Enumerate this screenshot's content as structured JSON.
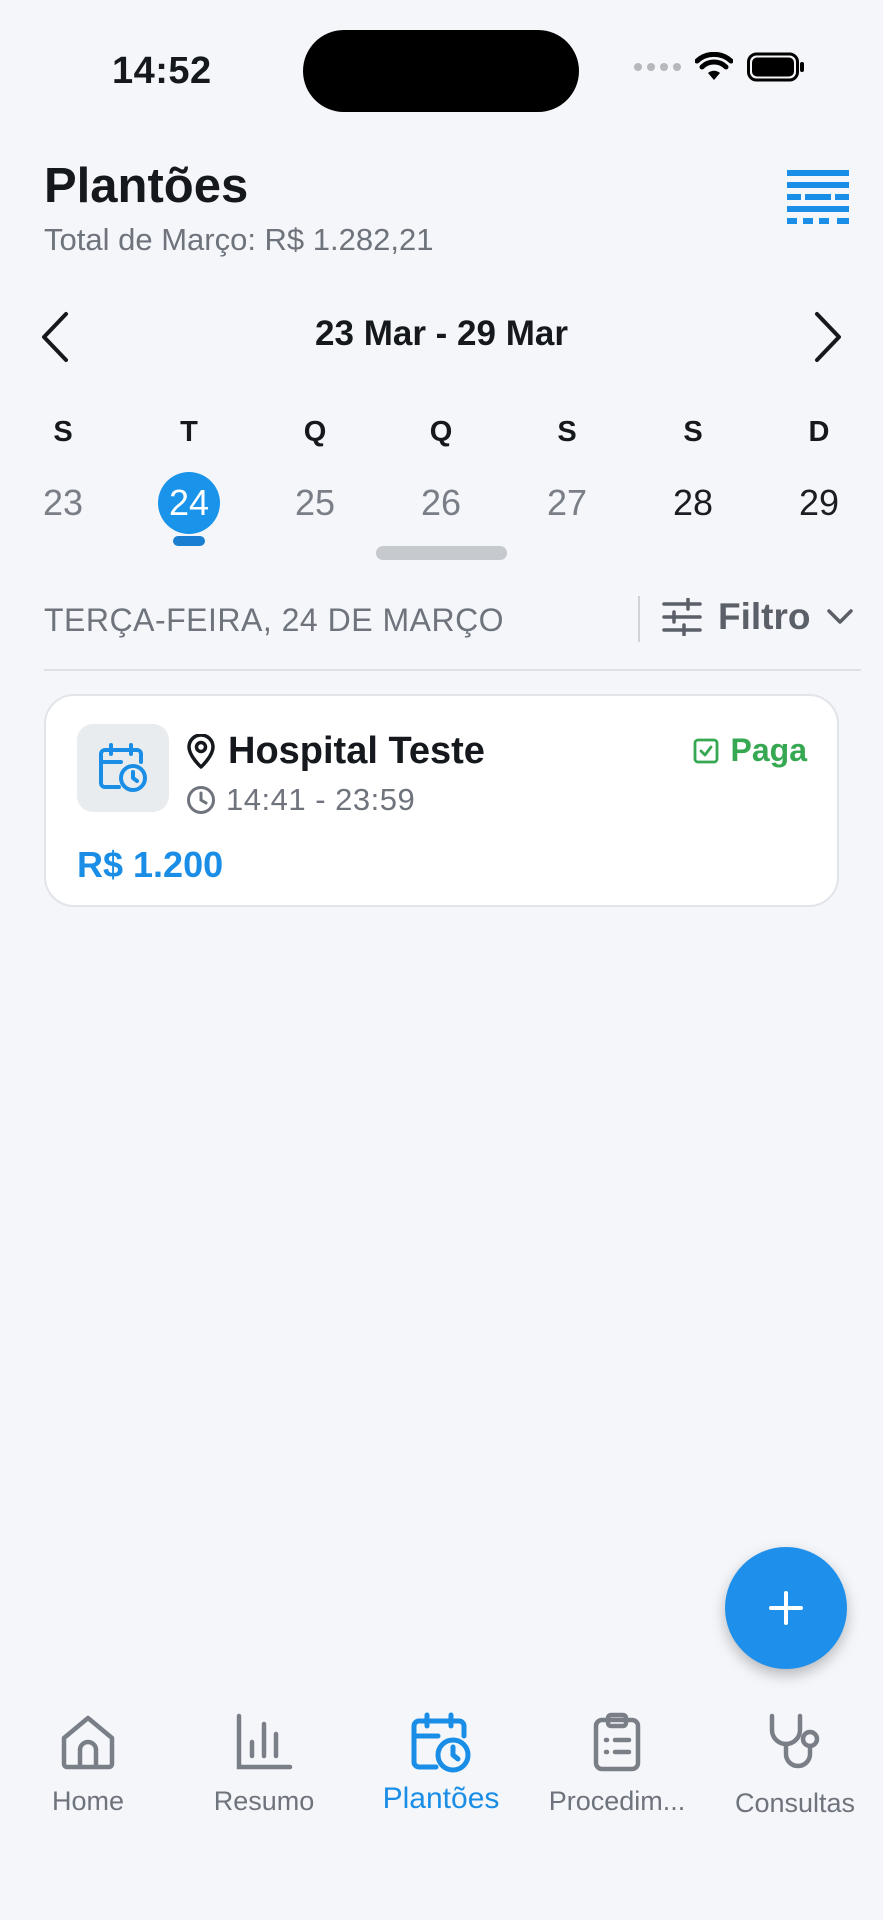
{
  "status_bar": {
    "time": "14:52"
  },
  "header": {
    "title": "Plantões",
    "subtitle": "Total de Março: R$ 1.282,21",
    "menu_icon": "table-icon"
  },
  "week": {
    "label": "23 Mar - 29 Mar",
    "days": [
      {
        "letter": "S",
        "number": "23"
      },
      {
        "letter": "T",
        "number": "24",
        "selected": true
      },
      {
        "letter": "Q",
        "number": "25"
      },
      {
        "letter": "Q",
        "number": "26"
      },
      {
        "letter": "S",
        "number": "27"
      },
      {
        "letter": "S",
        "number": "28"
      },
      {
        "letter": "D",
        "number": "29"
      }
    ]
  },
  "section": {
    "label": "TERÇA-FEIRA, 24 DE MARÇO",
    "filter_label": "Filtro"
  },
  "shifts": [
    {
      "place": "Hospital Teste",
      "time": "14:41 - 23:59",
      "status": "Paga",
      "amount": "R$ 1.200"
    }
  ],
  "tabbar": {
    "items": [
      {
        "label": "Home",
        "icon": "home-icon"
      },
      {
        "label": "Resumo",
        "icon": "bar-chart-icon"
      },
      {
        "label": "Plantões",
        "icon": "calendar-clock-icon",
        "active": true
      },
      {
        "label": "Procedim...",
        "icon": "clipboard-icon"
      },
      {
        "label": "Consultas",
        "icon": "stethoscope-icon"
      }
    ]
  },
  "colors": {
    "accent": "#1a8ee6",
    "status_paid": "#36a852",
    "background": "#f4f6fa"
  }
}
